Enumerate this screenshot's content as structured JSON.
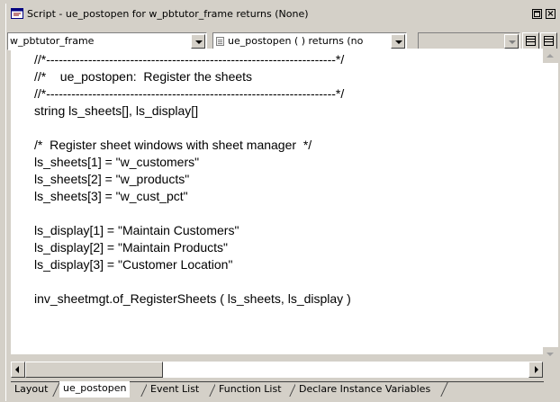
{
  "window": {
    "title": "Script - ue_postopen for w_pbtutor_frame returns (None)",
    "restore_glyph": "",
    "close_glyph": "×"
  },
  "toolbar": {
    "object_select": "w_pbtutor_frame",
    "event_select": "ue_postopen ( ) returns (no",
    "third_select": ""
  },
  "code": {
    "lines": [
      "//*---------------------------------------------------------------------*/",
      "//*    ue_postopen:  Register the sheets",
      "//*---------------------------------------------------------------------*/",
      "string ls_sheets[], ls_display[]",
      "",
      "/*  Register sheet windows with sheet manager  */",
      "ls_sheets[1] = \"w_customers\"",
      "ls_sheets[2] = \"w_products\"",
      "ls_sheets[3] = \"w_cust_pct\"",
      "",
      "ls_display[1] = \"Maintain Customers\"",
      "ls_display[2] = \"Maintain Products\"",
      "ls_display[3] = \"Customer Location\"",
      "",
      "inv_sheetmgt.of_RegisterSheets ( ls_sheets, ls_display )"
    ]
  },
  "tabs": [
    {
      "label": "Layout",
      "active": false
    },
    {
      "label": "ue_postopen",
      "active": true
    },
    {
      "label": "Event List",
      "active": false
    },
    {
      "label": "Function List",
      "active": false
    },
    {
      "label": "Declare Instance Variables",
      "active": false
    }
  ],
  "colors": {
    "chrome": "#d4d0c8",
    "editor_bg": "#ffffff"
  }
}
